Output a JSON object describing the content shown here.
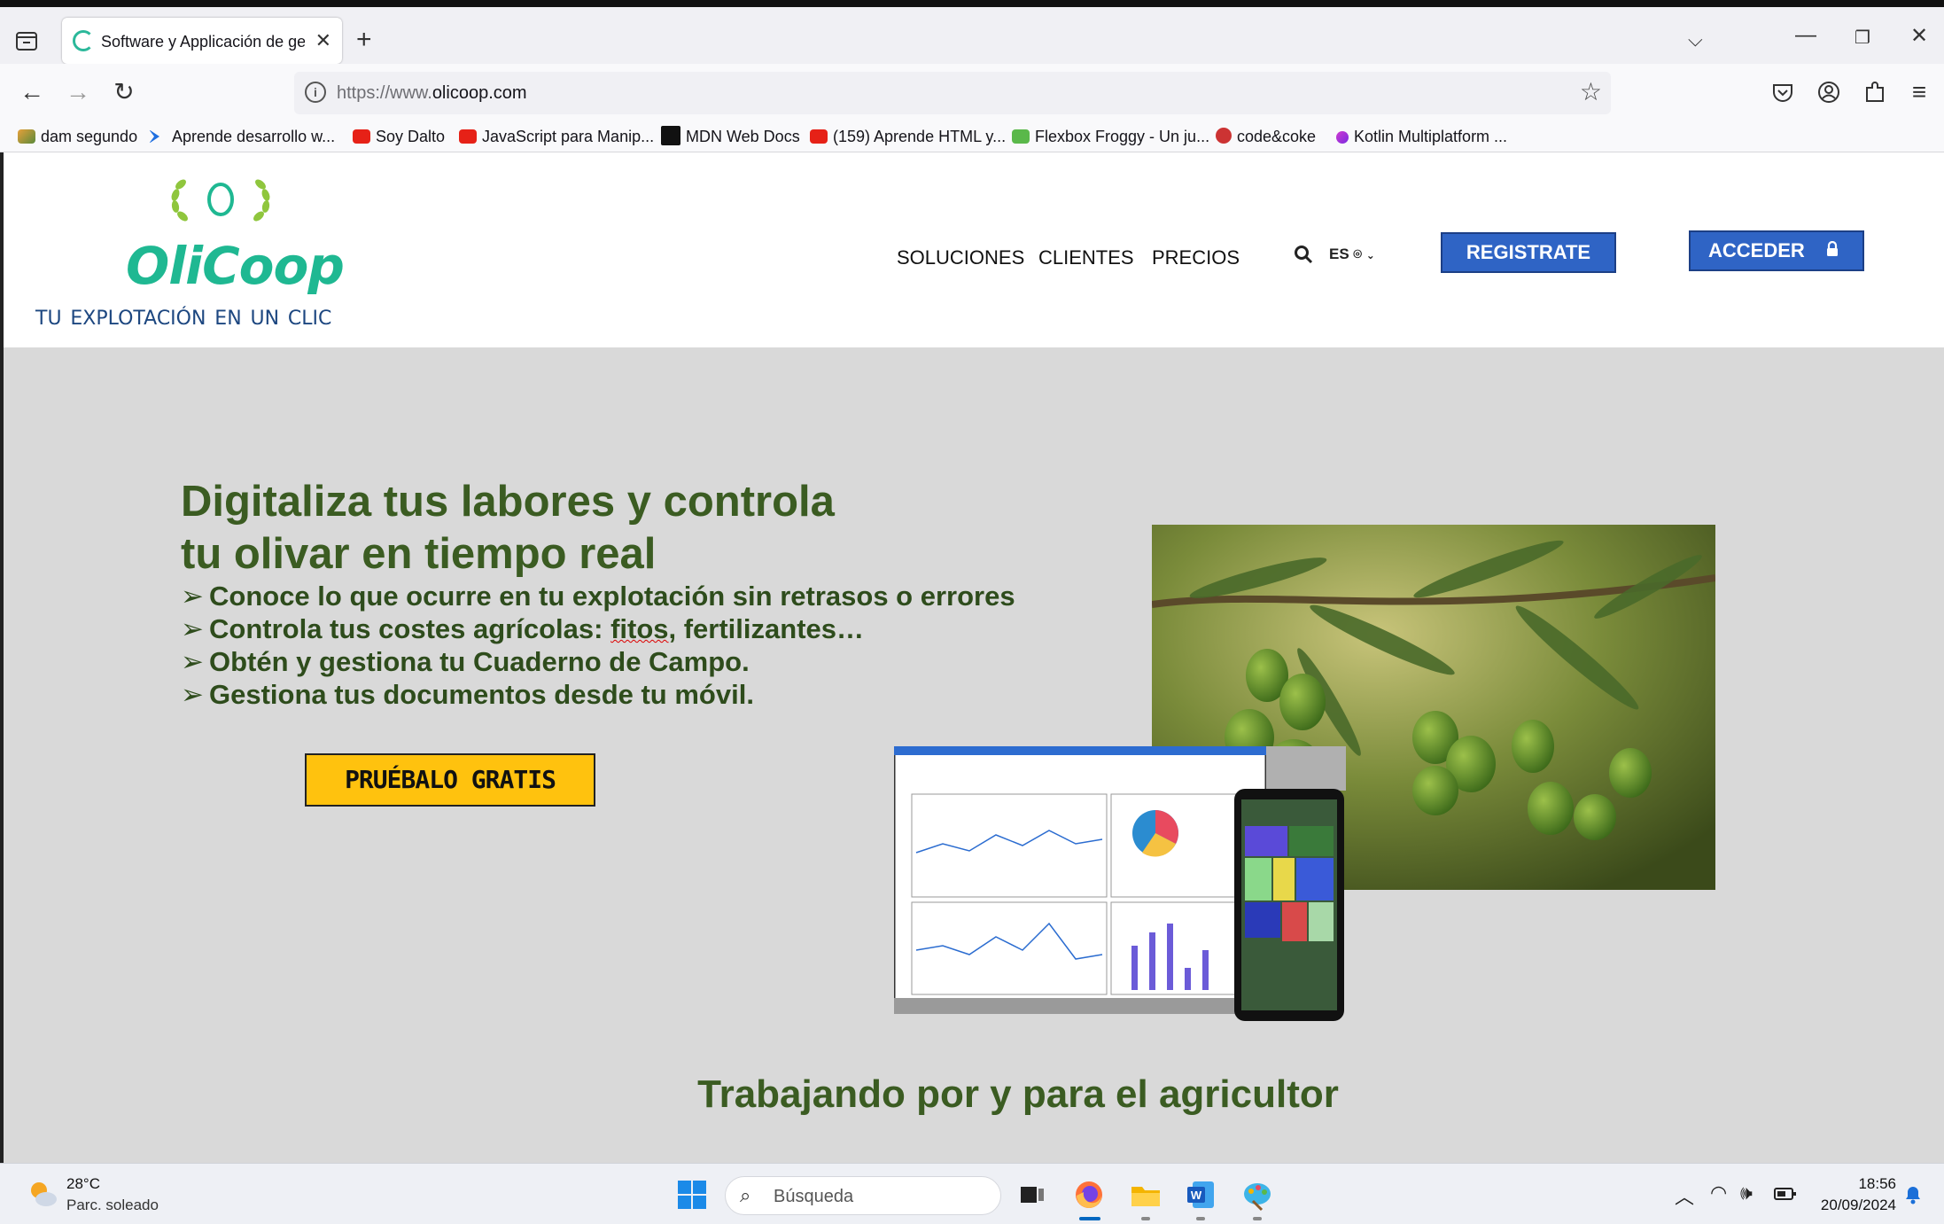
{
  "browser": {
    "tab_title": "Software y Applicación de gestión",
    "url_prefix": "https://www.",
    "url_domain": "olicoop.com",
    "bookmarks": [
      "dam segundo",
      "Aprende desarrollo w...",
      "Soy Dalto",
      "JavaScript para Manip...",
      "MDN Web Docs",
      "(159) Aprende HTML y...",
      "Flexbox Froggy - Un ju...",
      "code&coke",
      "Kotlin Multiplatform ..."
    ]
  },
  "site": {
    "brand": "OliCoop",
    "tagline": "tu explotación en un clic",
    "nav": [
      "SOLUCIONES",
      "CLIENTES",
      "PRECIOS"
    ],
    "lang": "ES",
    "register_label": "REGISTRATE",
    "login_label": "ACCEDER",
    "accent_green": "#1fb892",
    "button_blue": "#2f64c5"
  },
  "hero": {
    "title_line1": "Digitaliza tus labores y controla",
    "title_line2": "tu olivar en tiempo real",
    "bullet_marker": "➢",
    "bullets": [
      "Conoce lo que ocurre en tu explotación sin retrasos o errores",
      "Controla tus costes agrícolas: ",
      "Obtén y gestiona tu Cuaderno de Campo.",
      "Gestiona tus documentos desde tu móvil."
    ],
    "bullet2_misspelled": "fitos",
    "bullet2_rest": ", fertilizantes…",
    "cta_label": "PRUÉBALO GRATIS",
    "cta_color": "#ffc20e",
    "section_title": "Trabajando por y para el agricultor"
  },
  "taskbar": {
    "temperature": "28°C",
    "weather": "Parc. soleado",
    "search_placeholder": "Búsqueda",
    "time": "18:56",
    "date": "20/09/2024"
  }
}
